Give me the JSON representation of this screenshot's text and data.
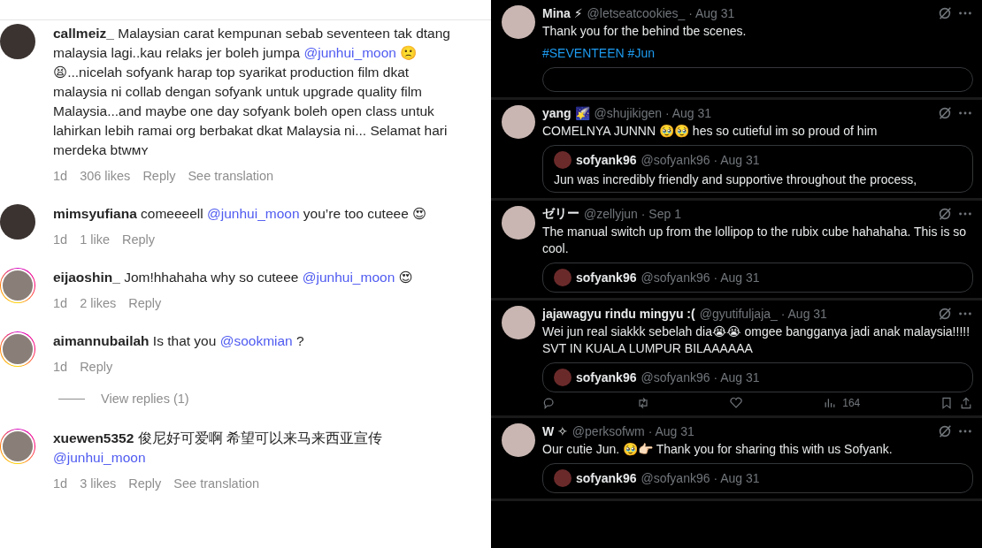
{
  "comments_panel": {
    "items": [
      {
        "kind": "comment",
        "username": "callmeiz_",
        "story_ring": false,
        "segments": [
          {
            "kind": "text",
            "text": "Malaysian carat kempunan sebab seventeen tak dtang malaysia lagi..kau relaks jer boleh jumpa "
          },
          {
            "kind": "mention",
            "text": "@junhui_moon"
          },
          {
            "kind": "text",
            "text": " 🙁😫...nicelah sofyank harap top syarikat production film dkat malaysia ni collab dengan sofyank untuk upgrade quality film Malaysia...and maybe one day sofyank boleh open class untuk lahirkan lebih ramai org berbakat dkat Malaysia ni... Selamat hari merdeka btwᴍʏ"
          }
        ],
        "time": "1d",
        "likes": "306 likes",
        "reply": "Reply",
        "translation": "See translation"
      },
      {
        "kind": "comment",
        "username": "mimsyufiana",
        "story_ring": false,
        "segments": [
          {
            "kind": "text",
            "text": "comeeeell "
          },
          {
            "kind": "mention",
            "text": "@junhui_moon"
          },
          {
            "kind": "text",
            "text": " you’re too cuteee 😍"
          }
        ],
        "time": "1d",
        "likes": "1 like",
        "reply": "Reply"
      },
      {
        "kind": "comment",
        "username": "eijaoshin_",
        "story_ring": true,
        "segments": [
          {
            "kind": "text",
            "text": "Jom!hhahaha why so cuteee "
          },
          {
            "kind": "mention",
            "text": "@junhui_moon"
          },
          {
            "kind": "text",
            "text": " 😍"
          }
        ],
        "time": "1d",
        "likes": "2 likes",
        "reply": "Reply"
      },
      {
        "kind": "comment",
        "username": "aimannubailah",
        "story_ring": true,
        "segments": [
          {
            "kind": "text",
            "text": "Is that you "
          },
          {
            "kind": "mention",
            "text": "@sookmian"
          },
          {
            "kind": "text",
            "text": " ?"
          }
        ],
        "time": "1d",
        "reply": "Reply"
      },
      {
        "kind": "view_replies",
        "label": "View replies (1)"
      },
      {
        "kind": "comment",
        "username": "xuewen5352",
        "story_ring": true,
        "segments": [
          {
            "kind": "text",
            "text": "俊尼好可爱啊 希望可以来马来西亚宣传 "
          },
          {
            "kind": "mention",
            "text": "@junhui_moon"
          }
        ],
        "time": "1d",
        "likes": "3 likes",
        "reply": "Reply",
        "translation": "See translation"
      }
    ]
  },
  "replies_panel": {
    "tweets": [
      {
        "name": "Mina ⚡",
        "meta": "@letseatcookies_ · Aug 31",
        "paragraphs": [
          [
            {
              "kind": "text",
              "text": "Thank you for the behind tbe scenes."
            }
          ],
          [
            {
              "kind": "hashtag",
              "text": "#SEVENTEEN"
            },
            {
              "kind": "hashtag",
              "text": "#Jun"
            }
          ]
        ],
        "quote": {
          "kind": "empty"
        }
      },
      {
        "name": "yang 🌠",
        "meta": "@shujikigen · Aug 31",
        "paragraphs": [
          [
            {
              "kind": "text",
              "text": "COMELNYA JUNNN 🥹🥹 hes so cutieful im so proud of him"
            }
          ]
        ],
        "quote": {
          "kind": "full",
          "name": "sofyank96",
          "meta": "@sofyank96 · Aug 31",
          "text": "Jun was incredibly friendly and supportive throughout the process,"
        }
      },
      {
        "name": "ゼリー",
        "meta": "@zellyjun · Sep 1",
        "paragraphs": [
          [
            {
              "kind": "text",
              "text": "The manual switch up from the lollipop to the rubix cube hahahaha. This is so cool."
            }
          ]
        ],
        "quote": {
          "kind": "header",
          "name": "sofyank96",
          "meta": "@sofyank96 · Aug 31"
        }
      },
      {
        "name": "jajawagyu rindu mingyu :(",
        "meta": "@gyutifuljaja_ · Aug 31",
        "paragraphs": [
          [
            {
              "kind": "text",
              "text": "Wei jun real siakkk sebelah dia😭😭 omgee bangganya jadi anak malaysia!!!!! SVT IN KUALA LUMPUR BILAAAAAA"
            }
          ]
        ],
        "quote": {
          "kind": "header",
          "name": "sofyank96",
          "meta": "@sofyank96 · Aug 31"
        },
        "actions": {
          "views": "164"
        }
      },
      {
        "name": "W ✧",
        "meta": "@perksofwm · Aug 31",
        "paragraphs": [
          [
            {
              "kind": "text",
              "text": "Our cutie Jun. 🥹👉🏻 Thank you for sharing this with us Sofyank."
            }
          ]
        ],
        "quote": {
          "kind": "header",
          "name": "sofyank96",
          "meta": "@sofyank96 · Aug 31"
        }
      }
    ]
  }
}
